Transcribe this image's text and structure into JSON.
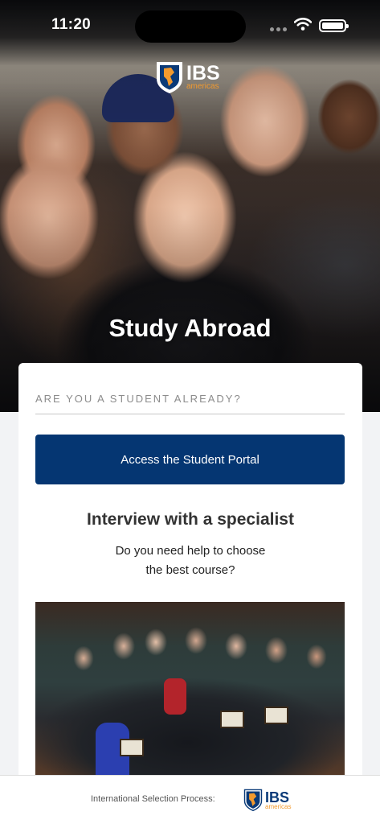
{
  "status_bar": {
    "time": "11:20"
  },
  "logo": {
    "brand": "IBS",
    "sub": "americas"
  },
  "hero": {
    "title": "Study Abroad"
  },
  "card": {
    "student_field": {
      "placeholder": "ARE YOU A STUDENT ALREADY?"
    },
    "portal_button": "Access the Student Portal",
    "interview": {
      "title": "Interview with a specialist",
      "subtitle_line1": "Do you need help to choose",
      "subtitle_line2": "the best course?"
    }
  },
  "footer": {
    "label": "International Selection Process:"
  },
  "colors": {
    "primary": "#053672",
    "accent": "#f39a2e",
    "logo_blue": "#0a3a78"
  }
}
